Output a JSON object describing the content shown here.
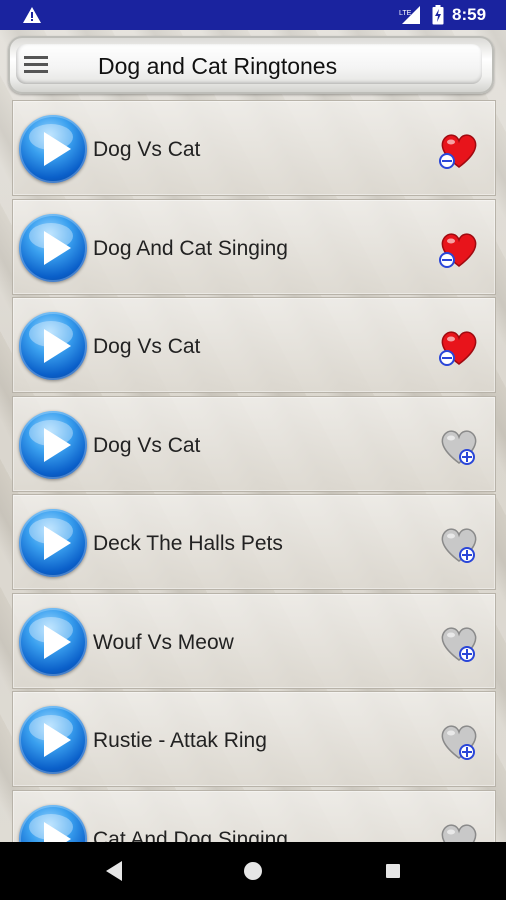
{
  "status_bar": {
    "time": "8:59",
    "network": "LTE",
    "icons": [
      "warning-icon",
      "lte-signal-icon",
      "battery-icon"
    ]
  },
  "app_bar": {
    "title": "Dog and Cat Ringtones",
    "menu_icon": "hamburger-menu-icon"
  },
  "ringtones": [
    {
      "title": "Dog Vs Cat",
      "favorite": true
    },
    {
      "title": "Dog And Cat Singing",
      "favorite": true
    },
    {
      "title": "Dog Vs Cat",
      "favorite": true
    },
    {
      "title": "Dog Vs Cat",
      "favorite": false
    },
    {
      "title": "Deck The Halls Pets",
      "favorite": false
    },
    {
      "title": "Wouf Vs Meow",
      "favorite": false
    },
    {
      "title": "Rustie - Attak Ring",
      "favorite": false
    },
    {
      "title": "Cat And Dog Singing",
      "favorite": false
    }
  ],
  "colors": {
    "status_bar": "#1a239f",
    "play_button": "#1a7ae0",
    "favorite_heart": "#e8141b",
    "not_favorite_heart": "#c8c8c8"
  },
  "nav_bar": {
    "icons": [
      "back-icon",
      "home-icon",
      "recents-icon"
    ]
  }
}
